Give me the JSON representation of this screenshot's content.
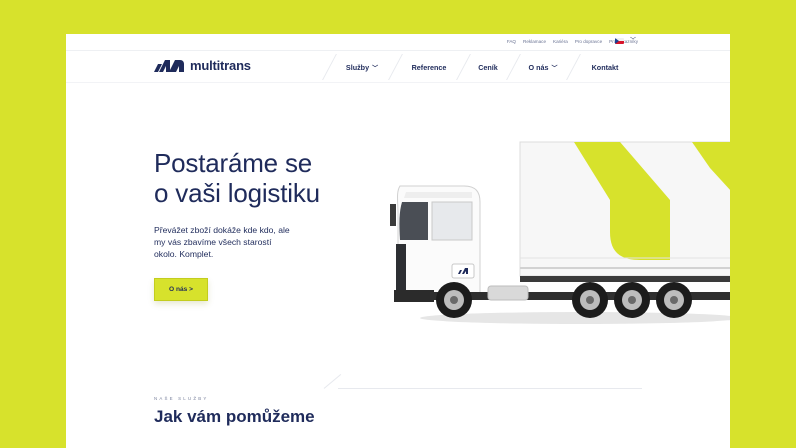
{
  "colors": {
    "accent": "#d7e22c",
    "brand": "#1f2b5b",
    "white": "#ffffff"
  },
  "utility_nav": {
    "links": [
      "FAQ",
      "Reklamace",
      "Kariéra",
      "Pro dopravce",
      "Pro zákazníky"
    ],
    "language_flag": "cz-flag-icon",
    "dropdown_icon": "chevron-down-icon"
  },
  "logo": {
    "text": "multitrans",
    "icon": "multitrans-logo-icon"
  },
  "nav": {
    "items": [
      {
        "label": "Služby",
        "has_caret": true
      },
      {
        "label": "Reference",
        "has_caret": false
      },
      {
        "label": "Ceník",
        "has_caret": false
      },
      {
        "label": "O nás",
        "has_caret": true
      },
      {
        "label": "Kontakt",
        "has_caret": false
      }
    ]
  },
  "hero": {
    "title_line1": "Postaráme se",
    "title_line2": "o vaši logistiku",
    "desc_line1": "Převážet zboží dokáže kde kdo, ale",
    "desc_line2": "my vás zbavíme všech starostí",
    "desc_line3": "okolo. Komplet.",
    "cta_label": "O nás >"
  },
  "services": {
    "eyebrow": "NAŠE SLUŽBY",
    "title": "Jak vám pomůžeme"
  }
}
